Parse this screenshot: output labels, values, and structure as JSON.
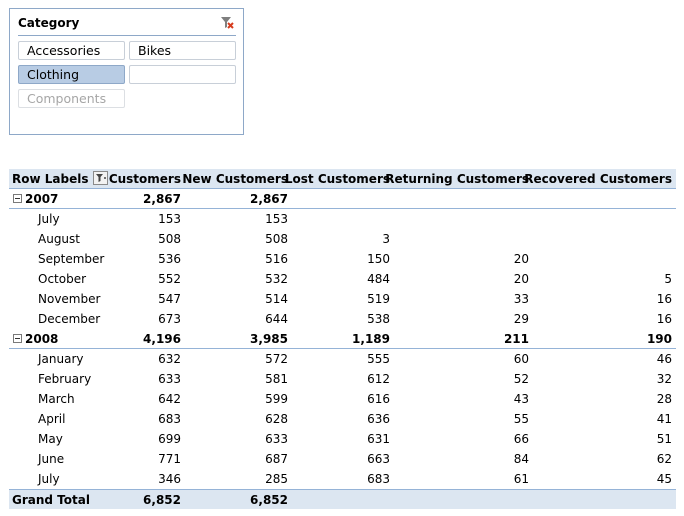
{
  "slicer": {
    "title": "Category",
    "items": [
      {
        "label": "Accessories",
        "state": "normal"
      },
      {
        "label": "Bikes",
        "state": "normal"
      },
      {
        "label": "Clothing",
        "state": "selected"
      },
      {
        "label": "",
        "state": "normal"
      },
      {
        "label": "Components",
        "state": "dim"
      }
    ]
  },
  "pivot": {
    "headers": {
      "row_labels": "Row Labels",
      "customers": "Customers",
      "new_customers": "New Customers",
      "lost_customers": "Lost Customers",
      "returning_customers": "Returning Customers",
      "recovered_customers": "Recovered Customers"
    },
    "groups": [
      {
        "year": "2007",
        "totals": {
          "customers": "2,867",
          "new": "2,867",
          "lost": "",
          "returning": "",
          "recovered": ""
        },
        "months": [
          {
            "label": "July",
            "customers": "153",
            "new": "153",
            "lost": "",
            "returning": "",
            "recovered": ""
          },
          {
            "label": "August",
            "customers": "508",
            "new": "508",
            "lost": "3",
            "returning": "",
            "recovered": ""
          },
          {
            "label": "September",
            "customers": "536",
            "new": "516",
            "lost": "150",
            "returning": "20",
            "recovered": ""
          },
          {
            "label": "October",
            "customers": "552",
            "new": "532",
            "lost": "484",
            "returning": "20",
            "recovered": "5"
          },
          {
            "label": "November",
            "customers": "547",
            "new": "514",
            "lost": "519",
            "returning": "33",
            "recovered": "16"
          },
          {
            "label": "December",
            "customers": "673",
            "new": "644",
            "lost": "538",
            "returning": "29",
            "recovered": "16"
          }
        ]
      },
      {
        "year": "2008",
        "totals": {
          "customers": "4,196",
          "new": "3,985",
          "lost": "1,189",
          "returning": "211",
          "recovered": "190"
        },
        "months": [
          {
            "label": "January",
            "customers": "632",
            "new": "572",
            "lost": "555",
            "returning": "60",
            "recovered": "46"
          },
          {
            "label": "February",
            "customers": "633",
            "new": "581",
            "lost": "612",
            "returning": "52",
            "recovered": "32"
          },
          {
            "label": "March",
            "customers": "642",
            "new": "599",
            "lost": "616",
            "returning": "43",
            "recovered": "28"
          },
          {
            "label": "April",
            "customers": "683",
            "new": "628",
            "lost": "636",
            "returning": "55",
            "recovered": "41"
          },
          {
            "label": "May",
            "customers": "699",
            "new": "633",
            "lost": "631",
            "returning": "66",
            "recovered": "51"
          },
          {
            "label": "June",
            "customers": "771",
            "new": "687",
            "lost": "663",
            "returning": "84",
            "recovered": "62"
          },
          {
            "label": "July",
            "customers": "346",
            "new": "285",
            "lost": "683",
            "returning": "61",
            "recovered": "45"
          }
        ]
      }
    ],
    "grand_total": {
      "label": "Grand Total",
      "customers": "6,852",
      "new": "6,852",
      "lost": "",
      "returning": "",
      "recovered": ""
    }
  }
}
